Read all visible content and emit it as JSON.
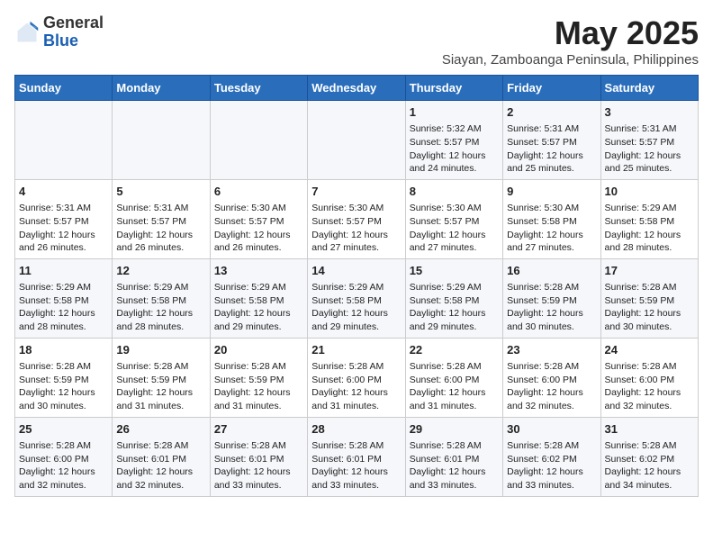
{
  "header": {
    "logo_line1": "General",
    "logo_line2": "Blue",
    "title": "May 2025",
    "subtitle": "Siayan, Zamboanga Peninsula, Philippines"
  },
  "weekdays": [
    "Sunday",
    "Monday",
    "Tuesday",
    "Wednesday",
    "Thursday",
    "Friday",
    "Saturday"
  ],
  "weeks": [
    [
      {
        "day": "",
        "info": ""
      },
      {
        "day": "",
        "info": ""
      },
      {
        "day": "",
        "info": ""
      },
      {
        "day": "",
        "info": ""
      },
      {
        "day": "1",
        "info": "Sunrise: 5:32 AM\nSunset: 5:57 PM\nDaylight: 12 hours\nand 24 minutes."
      },
      {
        "day": "2",
        "info": "Sunrise: 5:31 AM\nSunset: 5:57 PM\nDaylight: 12 hours\nand 25 minutes."
      },
      {
        "day": "3",
        "info": "Sunrise: 5:31 AM\nSunset: 5:57 PM\nDaylight: 12 hours\nand 25 minutes."
      }
    ],
    [
      {
        "day": "4",
        "info": "Sunrise: 5:31 AM\nSunset: 5:57 PM\nDaylight: 12 hours\nand 26 minutes."
      },
      {
        "day": "5",
        "info": "Sunrise: 5:31 AM\nSunset: 5:57 PM\nDaylight: 12 hours\nand 26 minutes."
      },
      {
        "day": "6",
        "info": "Sunrise: 5:30 AM\nSunset: 5:57 PM\nDaylight: 12 hours\nand 26 minutes."
      },
      {
        "day": "7",
        "info": "Sunrise: 5:30 AM\nSunset: 5:57 PM\nDaylight: 12 hours\nand 27 minutes."
      },
      {
        "day": "8",
        "info": "Sunrise: 5:30 AM\nSunset: 5:57 PM\nDaylight: 12 hours\nand 27 minutes."
      },
      {
        "day": "9",
        "info": "Sunrise: 5:30 AM\nSunset: 5:58 PM\nDaylight: 12 hours\nand 27 minutes."
      },
      {
        "day": "10",
        "info": "Sunrise: 5:29 AM\nSunset: 5:58 PM\nDaylight: 12 hours\nand 28 minutes."
      }
    ],
    [
      {
        "day": "11",
        "info": "Sunrise: 5:29 AM\nSunset: 5:58 PM\nDaylight: 12 hours\nand 28 minutes."
      },
      {
        "day": "12",
        "info": "Sunrise: 5:29 AM\nSunset: 5:58 PM\nDaylight: 12 hours\nand 28 minutes."
      },
      {
        "day": "13",
        "info": "Sunrise: 5:29 AM\nSunset: 5:58 PM\nDaylight: 12 hours\nand 29 minutes."
      },
      {
        "day": "14",
        "info": "Sunrise: 5:29 AM\nSunset: 5:58 PM\nDaylight: 12 hours\nand 29 minutes."
      },
      {
        "day": "15",
        "info": "Sunrise: 5:29 AM\nSunset: 5:58 PM\nDaylight: 12 hours\nand 29 minutes."
      },
      {
        "day": "16",
        "info": "Sunrise: 5:28 AM\nSunset: 5:59 PM\nDaylight: 12 hours\nand 30 minutes."
      },
      {
        "day": "17",
        "info": "Sunrise: 5:28 AM\nSunset: 5:59 PM\nDaylight: 12 hours\nand 30 minutes."
      }
    ],
    [
      {
        "day": "18",
        "info": "Sunrise: 5:28 AM\nSunset: 5:59 PM\nDaylight: 12 hours\nand 30 minutes."
      },
      {
        "day": "19",
        "info": "Sunrise: 5:28 AM\nSunset: 5:59 PM\nDaylight: 12 hours\nand 31 minutes."
      },
      {
        "day": "20",
        "info": "Sunrise: 5:28 AM\nSunset: 5:59 PM\nDaylight: 12 hours\nand 31 minutes."
      },
      {
        "day": "21",
        "info": "Sunrise: 5:28 AM\nSunset: 6:00 PM\nDaylight: 12 hours\nand 31 minutes."
      },
      {
        "day": "22",
        "info": "Sunrise: 5:28 AM\nSunset: 6:00 PM\nDaylight: 12 hours\nand 31 minutes."
      },
      {
        "day": "23",
        "info": "Sunrise: 5:28 AM\nSunset: 6:00 PM\nDaylight: 12 hours\nand 32 minutes."
      },
      {
        "day": "24",
        "info": "Sunrise: 5:28 AM\nSunset: 6:00 PM\nDaylight: 12 hours\nand 32 minutes."
      }
    ],
    [
      {
        "day": "25",
        "info": "Sunrise: 5:28 AM\nSunset: 6:00 PM\nDaylight: 12 hours\nand 32 minutes."
      },
      {
        "day": "26",
        "info": "Sunrise: 5:28 AM\nSunset: 6:01 PM\nDaylight: 12 hours\nand 32 minutes."
      },
      {
        "day": "27",
        "info": "Sunrise: 5:28 AM\nSunset: 6:01 PM\nDaylight: 12 hours\nand 33 minutes."
      },
      {
        "day": "28",
        "info": "Sunrise: 5:28 AM\nSunset: 6:01 PM\nDaylight: 12 hours\nand 33 minutes."
      },
      {
        "day": "29",
        "info": "Sunrise: 5:28 AM\nSunset: 6:01 PM\nDaylight: 12 hours\nand 33 minutes."
      },
      {
        "day": "30",
        "info": "Sunrise: 5:28 AM\nSunset: 6:02 PM\nDaylight: 12 hours\nand 33 minutes."
      },
      {
        "day": "31",
        "info": "Sunrise: 5:28 AM\nSunset: 6:02 PM\nDaylight: 12 hours\nand 34 minutes."
      }
    ]
  ]
}
